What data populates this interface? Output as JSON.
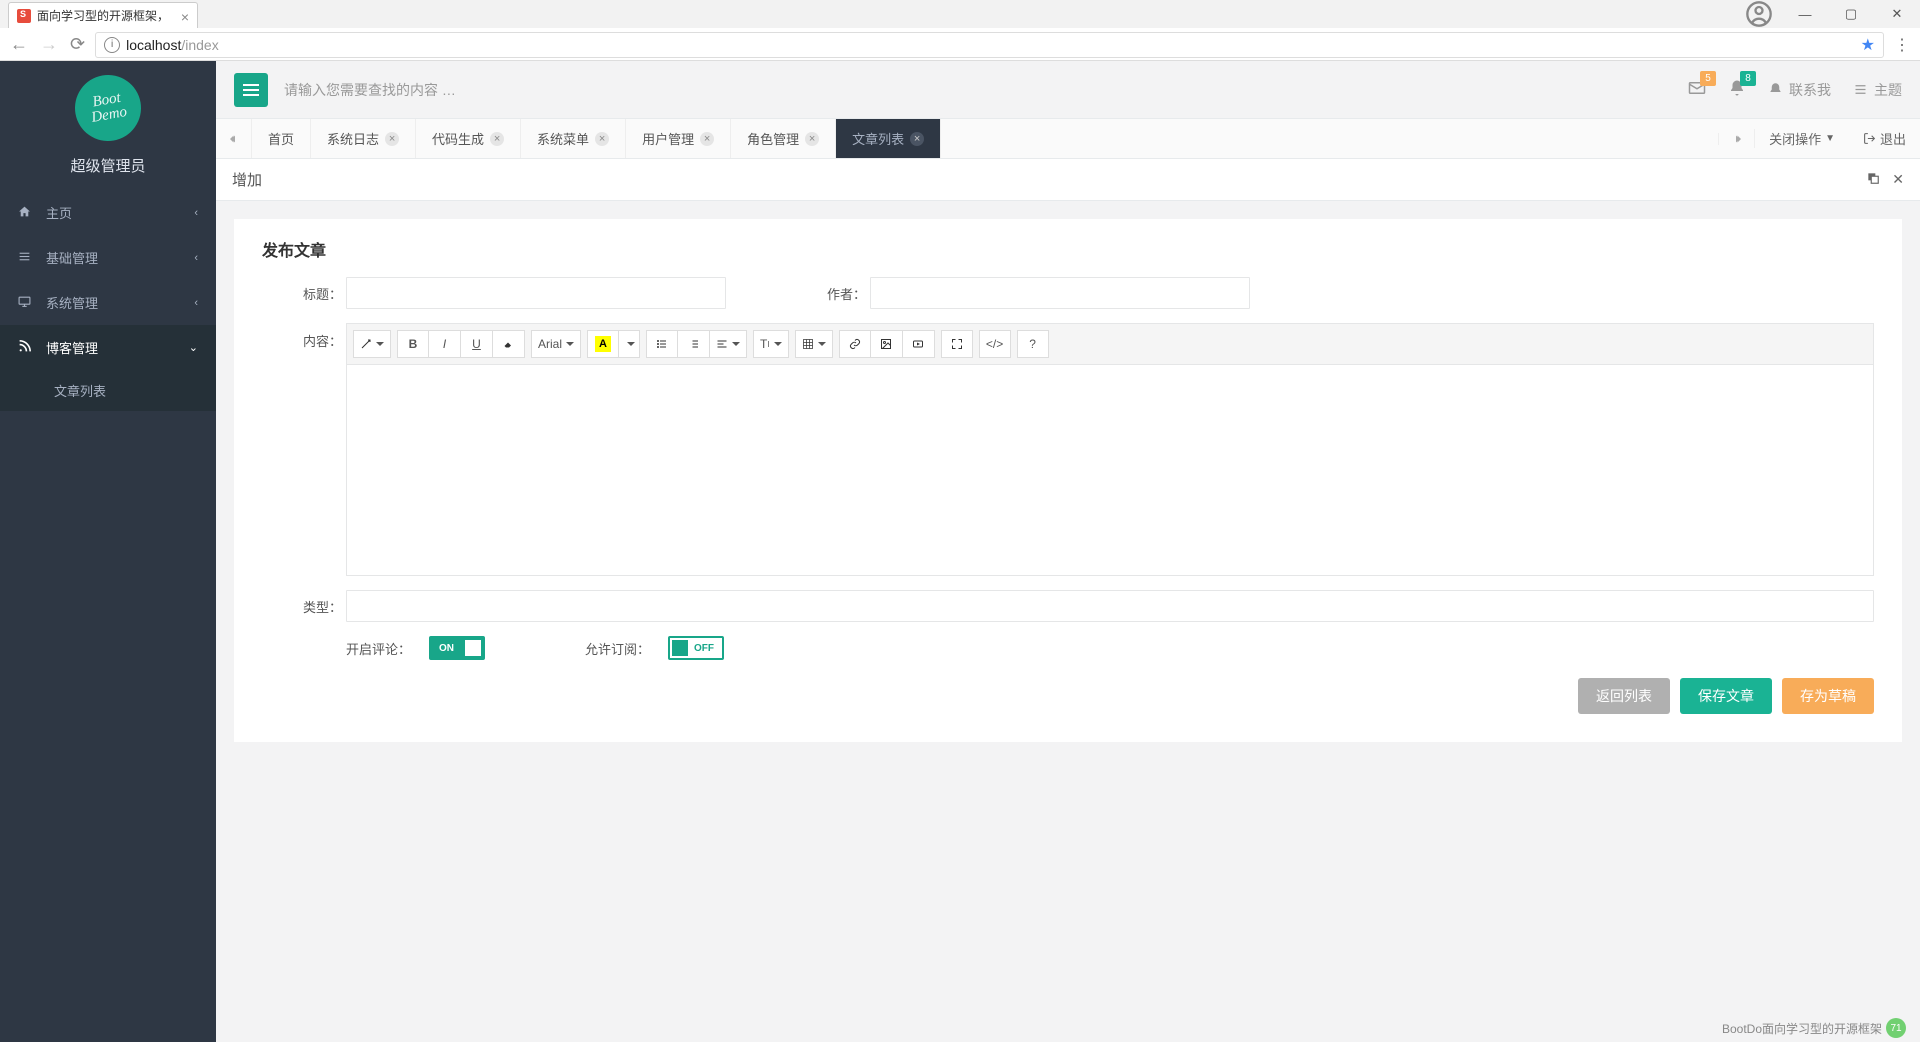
{
  "browser": {
    "tab_title": "面向学习型的开源框架，",
    "address_host": "localhost",
    "address_path": "/index"
  },
  "sidebar": {
    "logo_text": "Boot\nDemo",
    "admin_name": "超级管理员",
    "items": [
      {
        "label": "主页"
      },
      {
        "label": "基础管理"
      },
      {
        "label": "系统管理"
      },
      {
        "label": "博客管理"
      }
    ],
    "blog_sub": {
      "label": "文章列表"
    }
  },
  "header": {
    "search_placeholder": "请输入您需要查找的内容 …",
    "mail_badge": "5",
    "bell_badge": "8",
    "contact_label": "联系我",
    "theme_label": "主题"
  },
  "tabs": {
    "items": [
      {
        "label": "首页",
        "closable": false
      },
      {
        "label": "系统日志",
        "closable": true
      },
      {
        "label": "代码生成",
        "closable": true
      },
      {
        "label": "系统菜单",
        "closable": true
      },
      {
        "label": "用户管理",
        "closable": true
      },
      {
        "label": "角色管理",
        "closable": true
      },
      {
        "label": "文章列表",
        "closable": true,
        "active": true
      }
    ],
    "close_ops": "关闭操作",
    "logout": "退出"
  },
  "panel": {
    "title": "增加"
  },
  "form": {
    "heading": "发布文章",
    "labels": {
      "title": "标题：",
      "author": "作者：",
      "content": "内容：",
      "type": "类型：",
      "enable_comment": "开启评论：",
      "allow_subscribe": "允许订阅："
    },
    "editor_font": "Arial",
    "switch_on": "ON",
    "switch_off": "OFF",
    "buttons": {
      "back": "返回列表",
      "save": "保存文章",
      "draft": "存为草稿"
    }
  },
  "footer_text": "BootDo面向学习型的开源框架",
  "footer_badge": "71"
}
